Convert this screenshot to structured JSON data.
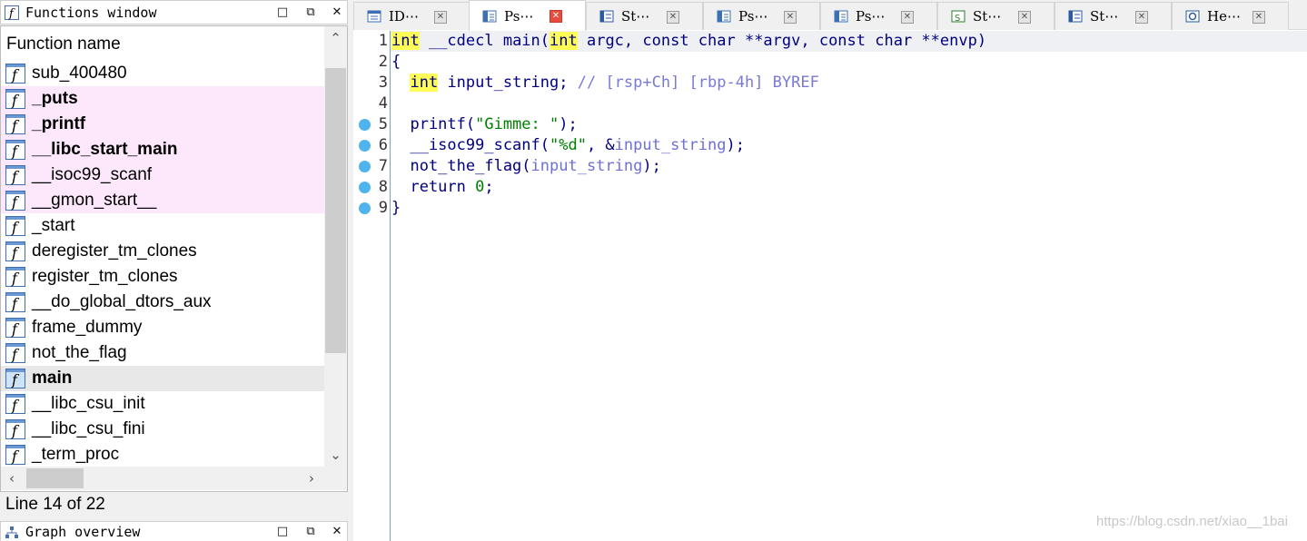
{
  "functions_window": {
    "title": "Functions window",
    "column_header": "Function name",
    "functions": [
      {
        "name": "sub_400480",
        "style": "normal"
      },
      {
        "name": "_puts",
        "style": "lib-bold"
      },
      {
        "name": "_printf",
        "style": "lib-bold"
      },
      {
        "name": "__libc_start_main",
        "style": "lib-bold"
      },
      {
        "name": "__isoc99_scanf",
        "style": "lib"
      },
      {
        "name": "__gmon_start__",
        "style": "lib"
      },
      {
        "name": "_start",
        "style": "normal"
      },
      {
        "name": "deregister_tm_clones",
        "style": "normal"
      },
      {
        "name": "register_tm_clones",
        "style": "normal"
      },
      {
        "name": "__do_global_dtors_aux",
        "style": "normal"
      },
      {
        "name": "frame_dummy",
        "style": "normal"
      },
      {
        "name": "not_the_flag",
        "style": "normal"
      },
      {
        "name": "main",
        "style": "selected-bold"
      },
      {
        "name": "__libc_csu_init",
        "style": "normal"
      },
      {
        "name": "__libc_csu_fini",
        "style": "normal"
      },
      {
        "name": "_term_proc",
        "style": "normal"
      }
    ],
    "status": "Line 14 of 22"
  },
  "graph_overview": {
    "title": "Graph overview"
  },
  "tabs": [
    {
      "label": "ID⋯",
      "icon": "ida-view-icon",
      "active": false
    },
    {
      "label": "Ps⋯",
      "icon": "pseudocode-icon",
      "active": true
    },
    {
      "label": "St⋯",
      "icon": "structures-icon",
      "active": false
    },
    {
      "label": "Ps⋯",
      "icon": "pseudocode-icon",
      "active": false
    },
    {
      "label": "Ps⋯",
      "icon": "pseudocode-icon",
      "active": false
    },
    {
      "label": "St⋯",
      "icon": "strings-icon",
      "active": false
    },
    {
      "label": "St⋯",
      "icon": "structures-icon",
      "active": false
    },
    {
      "label": "He⋯",
      "icon": "hex-view-icon",
      "active": false
    }
  ],
  "code": {
    "lines": [
      {
        "num": "1",
        "bp": false,
        "tokens": [
          [
            "kw",
            "int"
          ],
          [
            "p",
            " __cdecl main("
          ],
          [
            "kw",
            "int"
          ],
          [
            "p",
            " argc, const char **argv, const char **envp)"
          ]
        ]
      },
      {
        "num": "2",
        "bp": false,
        "tokens": [
          [
            "p",
            "{"
          ]
        ]
      },
      {
        "num": "3",
        "bp": false,
        "tokens": [
          [
            "p",
            "  "
          ],
          [
            "kw",
            "int"
          ],
          [
            "p",
            " input_string; "
          ],
          [
            "cmt",
            "// [rsp+Ch] [rbp-4h] BYREF"
          ]
        ]
      },
      {
        "num": "4",
        "bp": false,
        "tokens": []
      },
      {
        "num": "5",
        "bp": true,
        "tokens": [
          [
            "p",
            "  printf("
          ],
          [
            "str",
            "\"Gimme: \""
          ],
          [
            "p",
            ");"
          ]
        ]
      },
      {
        "num": "6",
        "bp": true,
        "tokens": [
          [
            "p",
            "  __isoc99_scanf("
          ],
          [
            "str",
            "\"%d\""
          ],
          [
            "p",
            ", &"
          ],
          [
            "var",
            "input_string"
          ],
          [
            "p",
            ");"
          ]
        ]
      },
      {
        "num": "7",
        "bp": true,
        "tokens": [
          [
            "p",
            "  not_the_flag("
          ],
          [
            "var",
            "input_string"
          ],
          [
            "p",
            ");"
          ]
        ]
      },
      {
        "num": "8",
        "bp": true,
        "tokens": [
          [
            "p",
            "  return "
          ],
          [
            "num",
            "0"
          ],
          [
            "p",
            ";"
          ]
        ]
      },
      {
        "num": "9",
        "bp": true,
        "tokens": [
          [
            "p",
            "}"
          ]
        ]
      }
    ]
  },
  "colors": {
    "lib_function_bg": "#fde7fb",
    "keyword_highlight": "#fdfd56",
    "breakpoint": "#4fb4ee",
    "active_tab_close": "#e74c3c"
  },
  "watermark": "https://blog.csdn.net/xiao__1bai"
}
